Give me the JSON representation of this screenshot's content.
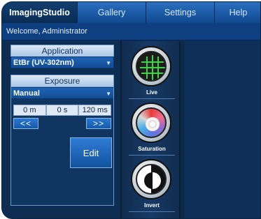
{
  "topbar": {
    "brand": "ImagingStudio",
    "tabs": [
      "Gallery",
      "Settings",
      "Help"
    ]
  },
  "welcome": "Welcome, Administrator",
  "application": {
    "header": "Application",
    "selected": "EtBr (UV-302nm)"
  },
  "exposure": {
    "header": "Exposure",
    "mode": "Manual",
    "time": {
      "minutes": "0 m",
      "seconds": "0 s",
      "milliseconds": "120 ms"
    },
    "decrease_label": "<<",
    "increase_label": ">>",
    "edit_label": "Edit"
  },
  "tools": [
    {
      "label": "Live",
      "icon": "grid-icon"
    },
    {
      "label": "Saturation",
      "icon": "color-wheel-icon"
    },
    {
      "label": "Invert",
      "icon": "invert-icon"
    }
  ],
  "colors": {
    "background": "#0c2a4a",
    "tab_active": "#0a2c55",
    "tab": "#10498f",
    "accent_green": "#3fd24a"
  }
}
